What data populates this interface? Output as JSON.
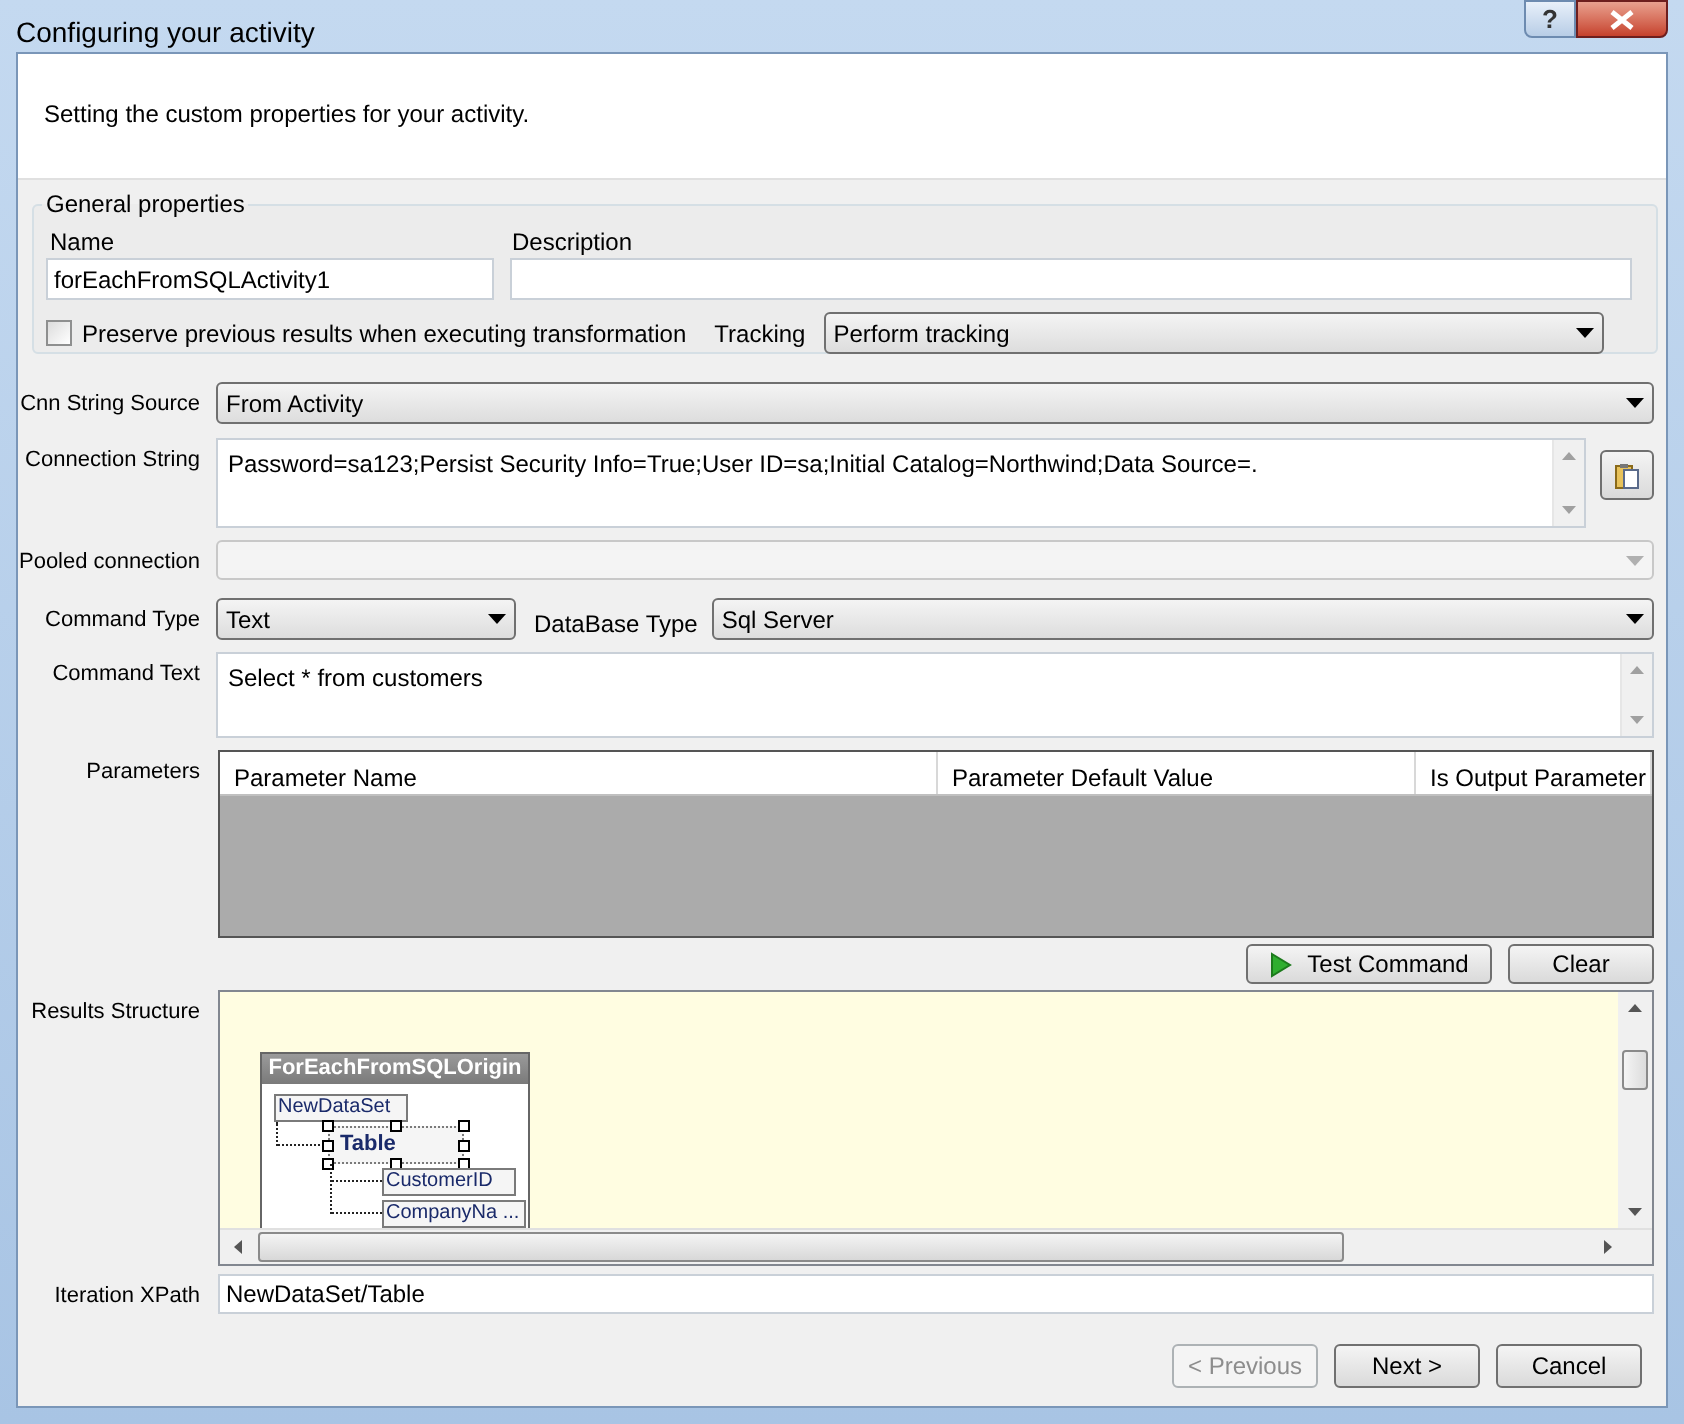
{
  "window": {
    "title": "Configuring your activity",
    "help_label": "?"
  },
  "header": {
    "text": "Setting the custom properties for your activity."
  },
  "general_properties": {
    "title": "General properties",
    "name_label": "Name",
    "name_value": "forEachFromSQLActivity1",
    "description_label": "Description",
    "preserve": {
      "label": "Preserve previous results when executing transformation",
      "checked": false
    },
    "tracking_label": "Tracking",
    "tracking_value": "Perform tracking"
  },
  "cnn_string_source": {
    "label": "Cnn String Source",
    "value": "From Activity"
  },
  "connection_string": {
    "label": "Connection String",
    "value": "Password=sa123;Persist Security Info=True;User ID=sa;Initial Catalog=Northwind;Data Source=."
  },
  "pooled_connection": {
    "label": "Pooled connection",
    "disabled": true
  },
  "command_type": {
    "label": "Command Type",
    "value": "Text"
  },
  "database_type": {
    "label": "DataBase Type",
    "value": "Sql Server"
  },
  "command_text": {
    "label": "Command Text",
    "value": "Select * from customers"
  },
  "parameters": {
    "label": "Parameters",
    "columns": [
      "Parameter Name",
      "Parameter Default Value",
      "Is Output Parameter"
    ]
  },
  "command_buttons": [
    {
      "label": "Test Command",
      "kind": "run"
    },
    {
      "label": "Clear",
      "kind": "plain"
    }
  ],
  "results_structure": {
    "label": "Results Structure",
    "diagram": {
      "title": "ForEachFromSQLOrigin",
      "nodes": [
        {
          "label": "NewDataSet",
          "selected": false,
          "children": [
            {
              "label": "Table",
              "selected": true,
              "children": [
                {
                  "label": "CustomerID",
                  "selected": false
                },
                {
                  "label": "CompanyNa ...",
                  "selected": false
                }
              ]
            }
          ]
        }
      ]
    }
  },
  "iteration_xpath": {
    "label": "Iteration XPath",
    "value": "NewDataSet/Table"
  },
  "footer_buttons": [
    {
      "label": "< Previous",
      "disabled": true
    },
    {
      "label": "Next >",
      "disabled": false
    },
    {
      "label": "Cancel",
      "disabled": false
    }
  ]
}
